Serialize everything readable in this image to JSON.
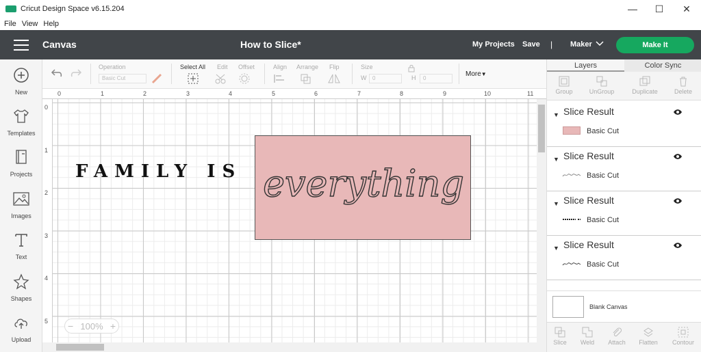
{
  "window": {
    "title": "Cricut Design Space  v6.15.204",
    "controls": {
      "minimize": "—",
      "maximize": "☐",
      "close": "✕"
    }
  },
  "menu": [
    "File",
    "View",
    "Help"
  ],
  "header": {
    "section": "Canvas",
    "doc_title": "How to Slice*",
    "my_projects": "My Projects",
    "save": "Save",
    "separator": "|",
    "machine": "Maker",
    "make_it": "Make It",
    "make_it_color": "#16a85f"
  },
  "left_tools": [
    {
      "label": "New",
      "icon": "plus-circle-icon"
    },
    {
      "label": "Templates",
      "icon": "tshirt-icon"
    },
    {
      "label": "Projects",
      "icon": "projects-icon"
    },
    {
      "label": "Images",
      "icon": "image-icon"
    },
    {
      "label": "Text",
      "icon": "text-icon"
    },
    {
      "label": "Shapes",
      "icon": "shapes-icon"
    },
    {
      "label": "Upload",
      "icon": "upload-icon"
    }
  ],
  "toolbar": {
    "operation": "Operation",
    "operation_value": "Basic Cut",
    "select_all": "Select All",
    "edit": "Edit",
    "offset": "Offset",
    "align": "Align",
    "arrange": "Arrange",
    "flip": "Flip",
    "size": "Size",
    "w": "W",
    "w_value": "0",
    "h": "H",
    "h_value": "0",
    "more": "More"
  },
  "canvas": {
    "ruler_top": [
      "0",
      "1",
      "2",
      "3",
      "4",
      "5",
      "6",
      "7",
      "8",
      "9",
      "10",
      "11"
    ],
    "ruler_left": [
      "0",
      "1",
      "2",
      "3",
      "4",
      "5"
    ],
    "text_family": "FAMILY IS",
    "text_everything": "everything",
    "pink_color": "#e8b8b8",
    "zoom": "100%"
  },
  "panel": {
    "tabs": [
      "Layers",
      "Color Sync"
    ],
    "tools": [
      "Group",
      "UnGroup",
      "Duplicate",
      "Delete"
    ],
    "layers": [
      {
        "name": "Slice Result",
        "sub": "Basic Cut",
        "thumb": "pink"
      },
      {
        "name": "Slice Result",
        "sub": "Basic Cut",
        "thumb": "script"
      },
      {
        "name": "Slice Result",
        "sub": "Basic Cut",
        "thumb": "family"
      },
      {
        "name": "Slice Result",
        "sub": "Basic Cut",
        "thumb": "script"
      }
    ],
    "blank_canvas": "Blank Canvas",
    "bottom_tools": [
      "Slice",
      "Weld",
      "Attach",
      "Flatten",
      "Contour"
    ]
  }
}
